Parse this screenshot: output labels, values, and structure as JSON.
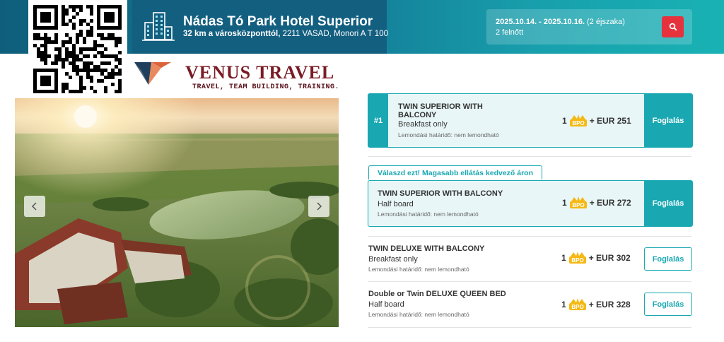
{
  "header": {
    "hotel_name": "Nádas Tó Park Hotel Superior",
    "distance": "32 km a városközponttól,",
    "address": " 2211 VASAD, Monori A T 100"
  },
  "search": {
    "dates": "2025.10.14. - 2025.10.16.",
    "nights": " (2 éjszaka)",
    "guests": "2 felnőtt",
    "icon": "search-icon"
  },
  "logo": {
    "name": "VENUS TRAVEL",
    "tagline": "TRAVEL, TEAM BUILDING, TRAINING."
  },
  "gallery": {
    "prev_icon": "chevron-left-icon",
    "next_icon": "chevron-right-icon"
  },
  "promo_label": "Válaszd ezt! Magasabb ellátás kedvező áron",
  "rooms": [
    {
      "rank": "#1",
      "name": "TWIN SUPERIOR WITH BALCONY",
      "board": "Breakfast only",
      "cancel": "Lemondási határidő: nem lemondható",
      "qty": "1",
      "badge": "BPO",
      "price": "+ EUR 251",
      "book": "Foglalás"
    },
    {
      "name": "TWIN SUPERIOR WITH BALCONY",
      "board": "Half board",
      "cancel": "Lemondási határidő: nem lemondható",
      "qty": "1",
      "badge": "BPO",
      "price": "+ EUR 272",
      "book": "Foglalás"
    },
    {
      "name": "TWIN DELUXE WITH BALCONY",
      "board": "Breakfast only",
      "cancel": "Lemondási határidő: nem lemondható",
      "qty": "1",
      "badge": "BPO",
      "price": "+ EUR 302",
      "book": "Foglalás"
    },
    {
      "name": "Double or Twin DELUXE QUEEN BED",
      "board": "Half board",
      "cancel": "Lemondási határidő: nem lemondható",
      "qty": "1",
      "badge": "BPO",
      "price": "+ EUR 328",
      "book": "Foglalás"
    }
  ],
  "colors": {
    "accent": "#19a8b2",
    "header_dark": "#135f80",
    "search_button": "#e5323d",
    "badge_gold": "#f5b915"
  }
}
